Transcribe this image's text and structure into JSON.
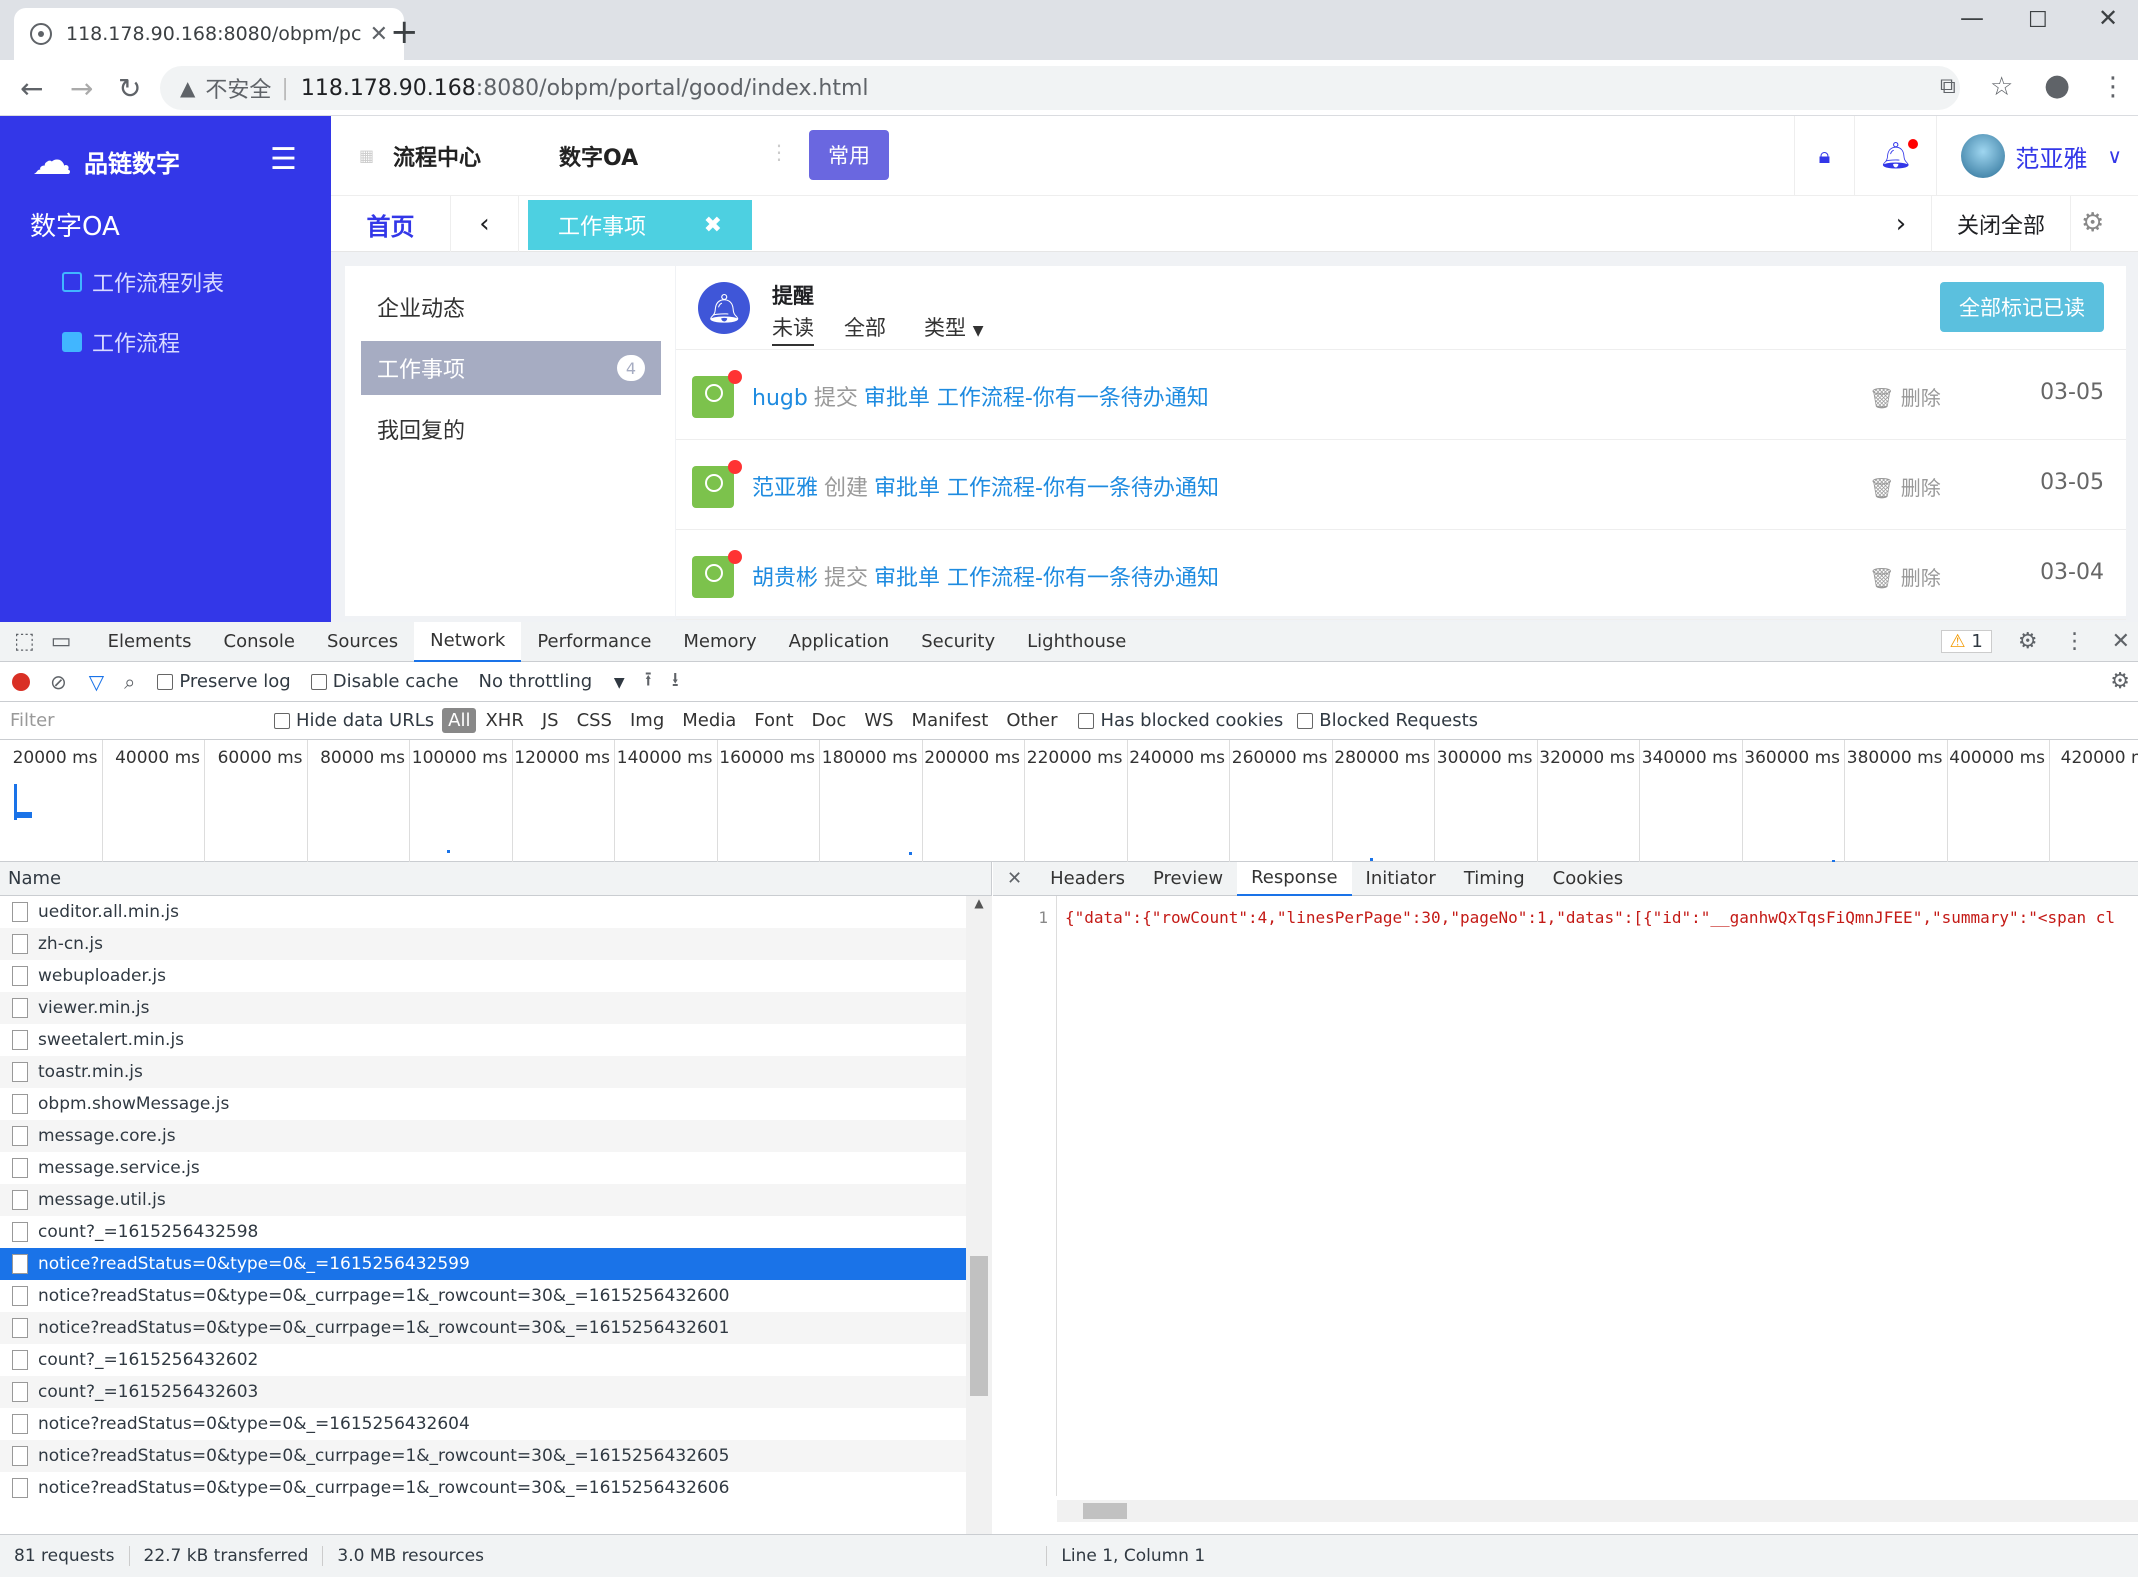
{
  "browser": {
    "tab_title": "118.178.90.168:8080/obpm/pc",
    "not_secure": "不安全",
    "url_host": "118.178.90.168",
    "url_path": ":8080/obpm/portal/good/index.html"
  },
  "app": {
    "logo_text": "品链数字",
    "system_name": "数字OA",
    "side_menu": [
      "工作流程列表",
      "工作流程"
    ],
    "top_nav": [
      "流程中心",
      "数字OA"
    ],
    "common_button": "常用",
    "user_name": "范亚雅",
    "home_tab": "首页",
    "active_tab": "工作事项",
    "close_all": "关闭全部",
    "left_panel": [
      {
        "label": "企业动态"
      },
      {
        "label": "工作事项",
        "badge": "4"
      },
      {
        "label": "我回复的"
      }
    ],
    "notice": {
      "title": "提醒",
      "tabs": [
        "未读",
        "全部",
        "类型"
      ],
      "mark_all_read": "全部标记已读",
      "delete_label": "删除",
      "rows": [
        {
          "who": "hugb",
          "action": "提交",
          "link": "审批单 工作流程-你有一条待办通知",
          "date": "03-05"
        },
        {
          "who": "范亚雅",
          "action": "创建",
          "link": "审批单 工作流程-你有一条待办通知",
          "date": "03-05"
        },
        {
          "who": "胡贵彬",
          "action": "提交",
          "link": "审批单 工作流程-你有一条待办通知",
          "date": "03-04"
        }
      ]
    }
  },
  "devtools": {
    "tabs": [
      "Elements",
      "Console",
      "Sources",
      "Network",
      "Performance",
      "Memory",
      "Application",
      "Security",
      "Lighthouse"
    ],
    "warning_count": "1",
    "toolbar": {
      "preserve_log": "Preserve log",
      "disable_cache": "Disable cache",
      "throttling": "No throttling"
    },
    "filter": {
      "placeholder": "Filter",
      "hide_data_urls": "Hide data URLs",
      "types": [
        "All",
        "XHR",
        "JS",
        "CSS",
        "Img",
        "Media",
        "Font",
        "Doc",
        "WS",
        "Manifest",
        "Other"
      ],
      "has_blocked": "Has blocked cookies",
      "blocked_requests": "Blocked Requests"
    },
    "timeline_ticks": [
      "20000 ms",
      "40000 ms",
      "60000 ms",
      "80000 ms",
      "100000 ms",
      "120000 ms",
      "140000 ms",
      "160000 ms",
      "180000 ms",
      "200000 ms",
      "220000 ms",
      "240000 ms",
      "260000 ms",
      "280000 ms",
      "300000 ms",
      "320000 ms",
      "340000 ms",
      "360000 ms",
      "380000 ms",
      "400000 ms",
      "420000 m"
    ],
    "name_header": "Name",
    "requests": [
      "ueditor.all.min.js",
      "zh-cn.js",
      "webuploader.js",
      "viewer.min.js",
      "sweetalert.min.js",
      "toastr.min.js",
      "obpm.showMessage.js",
      "message.core.js",
      "message.service.js",
      "message.util.js",
      "count?_=1615256432598",
      "notice?readStatus=0&type=0&_=1615256432599",
      "notice?readStatus=0&type=0&_currpage=1&_rowcount=30&_=1615256432600",
      "notice?readStatus=0&type=0&_currpage=1&_rowcount=30&_=1615256432601",
      "count?_=1615256432602",
      "count?_=1615256432603",
      "notice?readStatus=0&type=0&_=1615256432604",
      "notice?readStatus=0&type=0&_currpage=1&_rowcount=30&_=1615256432605",
      "notice?readStatus=0&type=0&_currpage=1&_rowcount=30&_=1615256432606"
    ],
    "selected_request": "notice?readStatus=0&type=0&_=1615256432599",
    "detail_tabs": [
      "Headers",
      "Preview",
      "Response",
      "Initiator",
      "Timing",
      "Cookies"
    ],
    "response_line_no": "1",
    "response_text": "{\"data\":{\"rowCount\":4,\"linesPerPage\":30,\"pageNo\":1,\"datas\":[{\"id\":\"__ganhwQxTqsFiQmnJFEE\",\"summary\":\"<span cl",
    "status": {
      "requests": "81 requests",
      "transferred": "22.7 kB transferred",
      "resources": "3.0 MB resources",
      "cursor": "Line 1, Column 1"
    }
  }
}
